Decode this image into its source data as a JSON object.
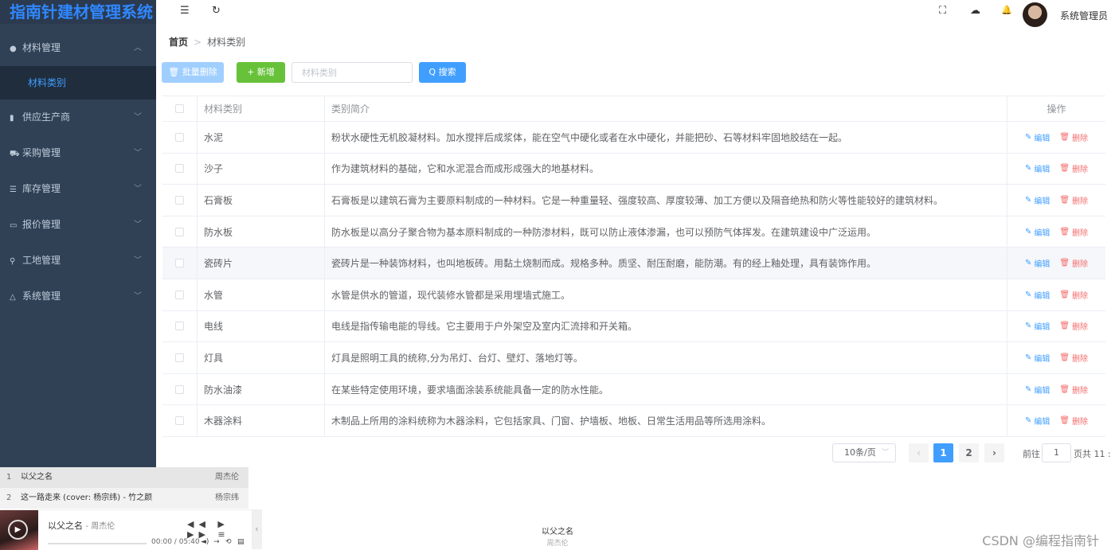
{
  "app": {
    "title": "指南针建材管理系统"
  },
  "sidebar": {
    "items": [
      {
        "label": "材料管理",
        "icon": "drop-icon",
        "glyph": "●"
      },
      {
        "label": "供应生产商",
        "icon": "building-icon",
        "glyph": "▮"
      },
      {
        "label": "采购管理",
        "icon": "cart-icon",
        "glyph": "⛟"
      },
      {
        "label": "库存管理",
        "icon": "database-icon",
        "glyph": "☰"
      },
      {
        "label": "报价管理",
        "icon": "money-icon",
        "glyph": "▭"
      },
      {
        "label": "工地管理",
        "icon": "location-icon",
        "glyph": "⚲"
      },
      {
        "label": "系统管理",
        "icon": "flask-icon",
        "glyph": "△"
      }
    ],
    "sub_item": "材料类别"
  },
  "header": {
    "menu_icon": "☰",
    "refresh_icon": "↻",
    "fullscreen_icon": "⛶",
    "cloud_icon": "☁",
    "bell_icon": "🔔",
    "user": "系统管理员"
  },
  "breadcrumb": {
    "home": "首页",
    "current": "材料类别"
  },
  "toolbar": {
    "batch_delete": "🗑 批量删除",
    "add": "+ 新增",
    "search_placeholder": "材料类别",
    "search": "Q 搜索"
  },
  "table": {
    "columns": {
      "name": "材料类别",
      "desc": "类别简介",
      "ops": "操作"
    },
    "edit_label": "编辑",
    "delete_label": "删除",
    "rows": [
      {
        "name": "水泥",
        "desc": "粉状水硬性无机胶凝材料。加水搅拌后成浆体，能在空气中硬化或者在水中硬化，并能把砂、石等材料牢固地胶结在一起。"
      },
      {
        "name": "沙子",
        "desc": "作为建筑材料的基础，它和水泥混合而成形成强大的地基材料。"
      },
      {
        "name": "石膏板",
        "desc": "石膏板是以建筑石膏为主要原料制成的一种材料。它是一种重量轻、强度较高、厚度较薄、加工方便以及隔音绝热和防火等性能较好的建筑材料。"
      },
      {
        "name": "防水板",
        "desc": "防水板是以高分子聚合物为基本原料制成的一种防渗材料，既可以防止液体渗漏，也可以预防气体挥发。在建筑建设中广泛运用。"
      },
      {
        "name": "瓷砖片",
        "desc": "瓷砖片是一种装饰材料，也叫地板砖。用黏土烧制而成。规格多种。质坚、耐压耐磨，能防潮。有的经上釉处理，具有装饰作用。"
      },
      {
        "name": "水管",
        "desc": "水管是供水的管道，现代装修水管都是采用埋墙式施工。"
      },
      {
        "name": "电线",
        "desc": "电线是指传输电能的导线。它主要用于户外架空及室内汇流排和开关箱。"
      },
      {
        "name": "灯具",
        "desc": "灯具是照明工具的统称,分为吊灯、台灯、壁灯、落地灯等。"
      },
      {
        "name": "防水油漆",
        "desc": "在某些特定使用环境，要求墙面涂装系统能具备一定的防水性能。"
      },
      {
        "name": "木器涂料",
        "desc": "木制品上所用的涂料统称为木器涂料，它包括家具、门窗、护墙板、地板、日常生活用品等所选用涂料。"
      }
    ]
  },
  "pagination": {
    "page_size": "10条/页",
    "pages": [
      "1",
      "2"
    ],
    "current": "1",
    "prev": "‹",
    "next": "›",
    "goto_label": "前往",
    "goto_value": "1",
    "total_label": "页共 11 :"
  },
  "player": {
    "playlist": [
      {
        "num": "1",
        "title": "以父之名",
        "artist": "周杰伦"
      },
      {
        "num": "2",
        "title": "这一路走来 (cover: 杨宗纬) - 竹之颜",
        "artist": "杨宗纬"
      }
    ],
    "now_title": "以父之名",
    "now_artist": "- 周杰伦",
    "controls": "◀◀ ▶ ▶▶ ≡",
    "time": "00:00 / 05:40",
    "progress": 0,
    "collapse": "‹"
  },
  "footer": {
    "song": "以父之名",
    "artist": "周杰伦",
    "watermark": "CSDN @编程指南针"
  }
}
